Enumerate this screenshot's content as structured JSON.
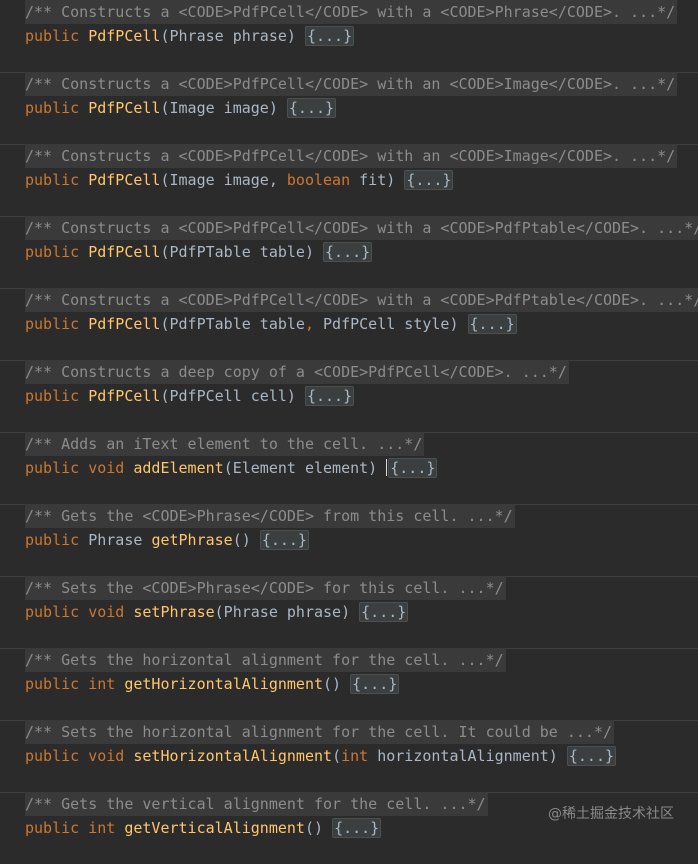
{
  "colors": {
    "background": "#2b2b2b",
    "keyword": "#cc7832",
    "method": "#ffc66d",
    "doc": "#8c8c8c",
    "text": "#a9b7c6"
  },
  "entries": [
    {
      "doc": "/** Constructs a <CODE>PdfPCell</CODE> with a <CODE>Phrase</CODE>. ...*/",
      "kw": "public ",
      "type": "",
      "name": "PdfPCell",
      "params": "(Phrase phrase) ",
      "fold": "{...}"
    },
    {
      "doc": "/** Constructs a <CODE>PdfPCell</CODE> with an <CODE>Image</CODE>. ...*/",
      "kw": "public ",
      "type": "",
      "name": "PdfPCell",
      "params": "(Image image) ",
      "fold": "{...}"
    },
    {
      "doc": "/** Constructs a <CODE>PdfPCell</CODE> with an <CODE>Image</CODE>. ...*/",
      "kw": "public ",
      "type": "",
      "name": "PdfPCell",
      "params_a": "(Image image, ",
      "kw2": "boolean",
      "params_b": " fit) ",
      "fold": "{...}"
    },
    {
      "doc": "/** Constructs a <CODE>PdfPCell</CODE> with a <CODE>PdfPtable</CODE>. ...*/",
      "kw": "public ",
      "type": "",
      "name": "PdfPCell",
      "params": "(PdfPTable table) ",
      "fold": "{...}"
    },
    {
      "doc": "/** Constructs a <CODE>PdfPCell</CODE> with a <CODE>PdfPtable</CODE>. ...*/",
      "kw": "public ",
      "type": "",
      "name": "PdfPCell",
      "params_a": "(PdfPTable table",
      "kw2": ",",
      "params_b": " PdfPCell style) ",
      "fold": "{...}"
    },
    {
      "doc": "/** Constructs a deep copy of a <CODE>PdfPCell</CODE>. ...*/",
      "kw": "public ",
      "type": "",
      "name": "PdfPCell",
      "params": "(PdfPCell cell) ",
      "fold": "{...}"
    },
    {
      "doc": "/** Adds an iText element to the cell. ...*/",
      "kw": "public void ",
      "type": "",
      "name": "addElement",
      "params": "(Element element) ",
      "fold": "{...}"
    },
    {
      "doc": "/** Gets the <CODE>Phrase</CODE> from this cell. ...*/",
      "kw": "public ",
      "type": "Phrase ",
      "name": "getPhrase",
      "params": "() ",
      "fold": "{...}"
    },
    {
      "doc": "/** Sets the <CODE>Phrase</CODE> for this cell. ...*/",
      "kw": "public void ",
      "type": "",
      "name": "setPhrase",
      "params": "(Phrase phrase) ",
      "fold": "{...}"
    },
    {
      "doc": "/** Gets the horizontal alignment for the cell. ...*/",
      "kw": "public int ",
      "type": "",
      "name": "getHorizontalAlignment",
      "params": "() ",
      "fold": "{...}"
    },
    {
      "doc": "/** Sets the horizontal alignment for the cell. It could be ...*/",
      "kw": "public void ",
      "type": "",
      "name": "setHorizontalAlignment",
      "params_a": "(",
      "kw2": "int",
      "params_b": " horizontalAlignment) ",
      "fold": "{...}"
    },
    {
      "doc": "/** Gets the vertical alignment for the cell. ...*/",
      "kw": "public int ",
      "type": "",
      "name": "getVerticalAlignment",
      "params": "() ",
      "fold": "{...}"
    }
  ],
  "watermark": "@稀土掘金技术社区"
}
